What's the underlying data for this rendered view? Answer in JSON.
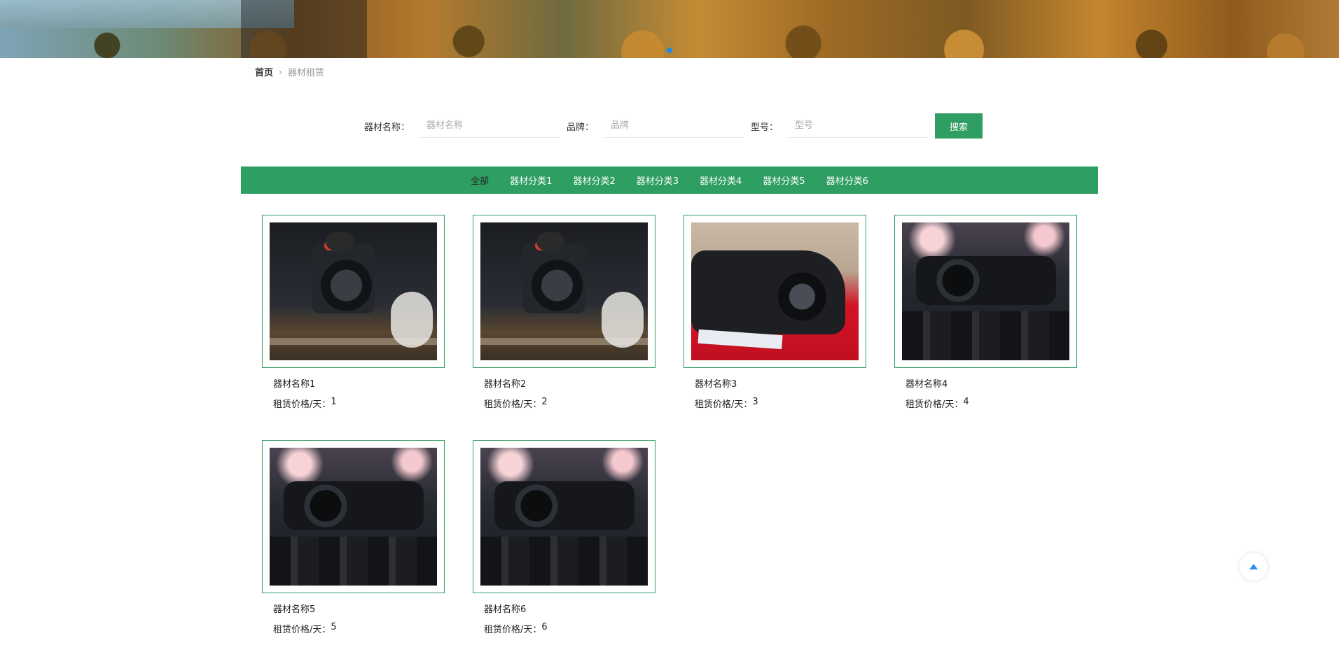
{
  "breadcrumb": {
    "home": "首页",
    "separator": "›",
    "current": "器材租赁"
  },
  "search": {
    "name_label": "器材名称：",
    "name_placeholder": "器材名称",
    "brand_label": "品牌：",
    "brand_placeholder": "品牌",
    "model_label": "型号：",
    "model_placeholder": "型号",
    "button_label": "搜索"
  },
  "categories": [
    "全部",
    "器材分类1",
    "器材分类2",
    "器材分类3",
    "器材分类4",
    "器材分类5",
    "器材分类6"
  ],
  "active_category": "全部",
  "price_label": "租赁价格/天：",
  "products": [
    {
      "name": "器材名称1",
      "price": "1",
      "image": "camera-slider-photo"
    },
    {
      "name": "器材名称2",
      "price": "2",
      "image": "camera-slider-photo"
    },
    {
      "name": "器材名称3",
      "price": "3",
      "image": "camcorder-on-red-table-photo"
    },
    {
      "name": "器材名称4",
      "price": "4",
      "image": "press-camera-crowd-photo"
    },
    {
      "name": "器材名称5",
      "price": "5",
      "image": "press-camera-crowd-photo"
    },
    {
      "name": "器材名称6",
      "price": "6",
      "image": "press-camera-crowd-photo"
    }
  ],
  "colors": {
    "accent": "#2e9e62",
    "to_top": "#2d8cf0"
  },
  "icons": {
    "back_to_top": "arrow-up-icon",
    "breadcrumb_separator": "chevron-right-icon"
  }
}
